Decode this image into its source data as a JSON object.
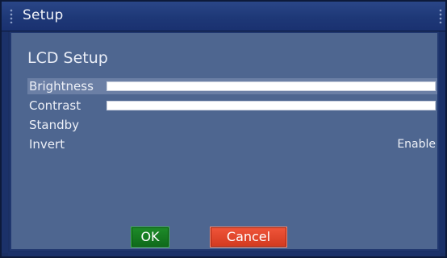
{
  "window": {
    "title": "Setup"
  },
  "section": {
    "title": "LCD Setup"
  },
  "settings": [
    {
      "label": "Brightness",
      "type": "slider",
      "level_percent": 100,
      "selected": true
    },
    {
      "label": "Contrast",
      "type": "slider",
      "level_percent": 100,
      "selected": false
    },
    {
      "label": "Standby",
      "type": "option",
      "value": "",
      "selected": false
    },
    {
      "label": "Invert",
      "type": "option",
      "value": "Enable",
      "selected": false
    }
  ],
  "buttons": {
    "ok_label": "OK",
    "cancel_label": "Cancel"
  },
  "colors": {
    "titlebar": "#1e3877",
    "panel": "#4e6690",
    "selection": "#6b7fa5",
    "ok_button": "#1a8626",
    "cancel_button": "#e8492d"
  },
  "icons": {
    "title_grip": "grip-dots-icon"
  }
}
